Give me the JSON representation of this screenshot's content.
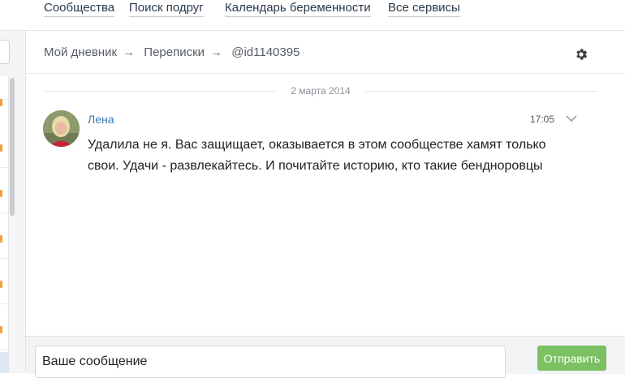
{
  "topnav": {
    "items": [
      "Сообщества",
      "Поиск подруг",
      "Календарь беременности",
      "Все сервисы"
    ]
  },
  "breadcrumb": {
    "items": [
      "Мой дневник",
      "Переписки",
      "@id1140395"
    ],
    "separator": "→"
  },
  "icons": {
    "settings": "gear-icon",
    "message_menu": "chevron-down-icon"
  },
  "thread": {
    "date_label": "2 марта 2014",
    "messages": [
      {
        "sender": "Лена",
        "time": "17:05",
        "text": "Удалила не я. Вас защищает, оказывается в этом сообществе хамят только свои. Удачи - развлекайтесь. И почитайте историю, кто такие бендноровцы"
      }
    ]
  },
  "composer": {
    "placeholder": "Ваше сообщение",
    "send_label": "Отправить"
  },
  "colors": {
    "link": "#3c79b3",
    "send_button": "#7bc162",
    "sidebar_badge": "#f0a23a"
  }
}
